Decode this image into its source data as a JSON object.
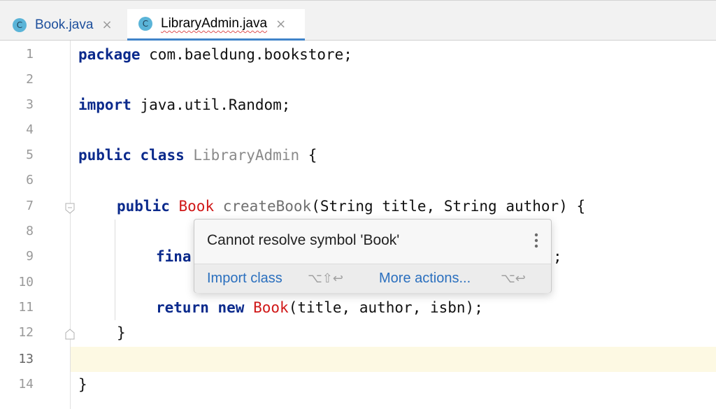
{
  "tabs": [
    {
      "label": "Book.java",
      "icon": "class-icon",
      "icon_text": "C",
      "close": "×",
      "active": false
    },
    {
      "label": "LibraryAdmin.java",
      "icon": "class-icon",
      "icon_text": "C",
      "close": "×",
      "active": true
    }
  ],
  "editor": {
    "line_numbers": [
      "1",
      "2",
      "3",
      "4",
      "5",
      "6",
      "7",
      "8",
      "9",
      "10",
      "11",
      "12",
      "13",
      "14"
    ],
    "current_line": "13",
    "code": {
      "l1_kw": "package",
      "l1_rest": " com.baeldung.bookstore;",
      "l3_kw": "import",
      "l3_rest": " java.util.Random;",
      "l5_kw1": "public",
      "l5_kw2": "class",
      "l5_cls": "LibraryAdmin",
      "l5_rest": " {",
      "l7_kw": "public",
      "l7_err": "Book",
      "l7_fn": "createBook",
      "l7_rest": "(String title, String author) {",
      "l9_kw": "fina",
      "l9_tail": ";",
      "l11_kw1": "return",
      "l11_kw2": "new",
      "l11_err": "Book",
      "l11_rest": "(title, author, isbn);",
      "l12": "}",
      "l14": "}"
    }
  },
  "popup": {
    "message": "Cannot resolve symbol 'Book'",
    "menu_icon": "more-vertical-icon",
    "actions": [
      {
        "label": "Import class",
        "shortcut": "⌥⇧↩"
      },
      {
        "label": "More actions...",
        "shortcut": "⌥↩"
      }
    ]
  },
  "colors": {
    "keyword": "#0b2a8c",
    "error": "#d01818",
    "link": "#2a6fbe",
    "current_line": "#fdf9e3",
    "tab_accent": "#4083c9"
  }
}
